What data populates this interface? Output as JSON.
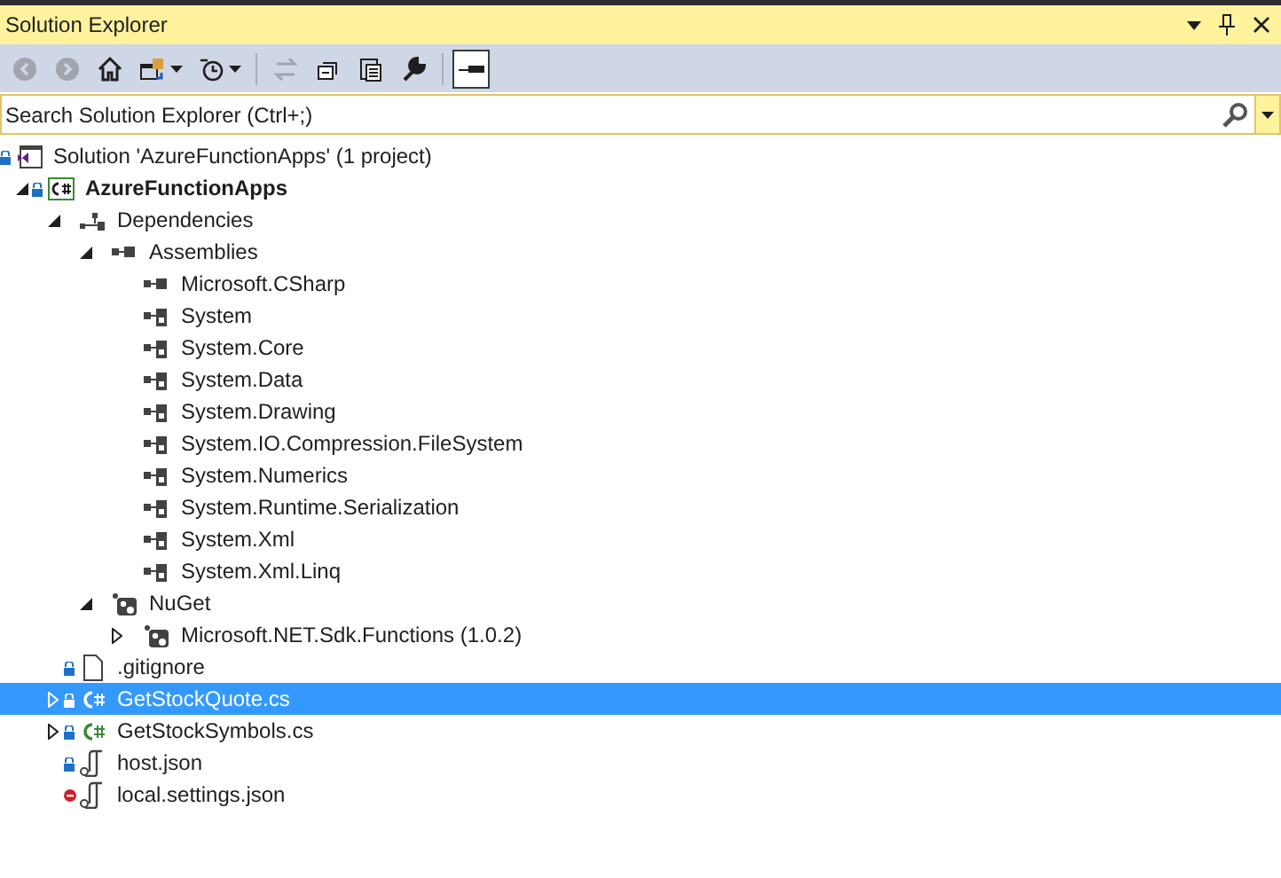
{
  "window": {
    "title": "Solution Explorer"
  },
  "toolbar": [
    {
      "disabled": true
    },
    {
      "disabled": true
    },
    {
      "disabled": false
    },
    {
      "disabled": false
    },
    {
      "disabled": false
    },
    {
      "disabled": true
    },
    {
      "disabled": false
    },
    {
      "disabled": false
    },
    {
      "disabled": false
    },
    {
      "disabled": false,
      "on": true
    }
  ],
  "search": {
    "placeholder": "Search Solution Explorer (Ctrl+;)"
  },
  "tree": [
    {
      "label": "Solution 'AzureFunctionApps' (1 project)",
      "kind": "solution",
      "locked": true,
      "excluded": false,
      "selected": false,
      "children": [
        {
          "label": "AzureFunctionApps",
          "kind": "project",
          "locked": true,
          "excluded": false,
          "expanded": true,
          "selected": false,
          "children": [
            {
              "label": "Dependencies",
              "kind": "dependencies",
              "expanded": true,
              "selected": false,
              "children": [
                {
                  "label": "Assemblies",
                  "kind": "assemblies",
                  "expanded": true,
                  "selected": false,
                  "children": [
                    {
                      "label": "Microsoft.CSharp",
                      "kind": "assembly",
                      "selected": false
                    },
                    {
                      "label": "System",
                      "kind": "framework-assembly",
                      "selected": false
                    },
                    {
                      "label": "System.Core",
                      "kind": "framework-assembly",
                      "selected": false
                    },
                    {
                      "label": "System.Data",
                      "kind": "framework-assembly",
                      "selected": false
                    },
                    {
                      "label": "System.Drawing",
                      "kind": "framework-assembly",
                      "selected": false
                    },
                    {
                      "label": "System.IO.Compression.FileSystem",
                      "kind": "framework-assembly",
                      "selected": false
                    },
                    {
                      "label": "System.Numerics",
                      "kind": "framework-assembly",
                      "selected": false
                    },
                    {
                      "label": "System.Runtime.Serialization",
                      "kind": "framework-assembly",
                      "selected": false
                    },
                    {
                      "label": "System.Xml",
                      "kind": "framework-assembly",
                      "selected": false
                    },
                    {
                      "label": "System.Xml.Linq",
                      "kind": "framework-assembly",
                      "selected": false
                    }
                  ]
                },
                {
                  "label": "NuGet",
                  "kind": "nuget",
                  "expanded": true,
                  "selected": false,
                  "children": [
                    {
                      "label": "Microsoft.NET.Sdk.Functions (1.0.2)",
                      "kind": "package",
                      "expanded": false,
                      "selected": false
                    }
                  ]
                }
              ]
            },
            {
              "label": ".gitignore",
              "kind": "file",
              "locked": true,
              "excluded": false,
              "selected": false
            },
            {
              "label": "GetStockQuote.cs",
              "kind": "csharp",
              "locked": true,
              "excluded": false,
              "expanded": false,
              "selected": true
            },
            {
              "label": "GetStockSymbols.cs",
              "kind": "csharp",
              "locked": true,
              "excluded": false,
              "expanded": false,
              "selected": false
            },
            {
              "label": "host.json",
              "kind": "json",
              "locked": true,
              "excluded": false,
              "selected": false
            },
            {
              "label": "local.settings.json",
              "kind": "json",
              "locked": false,
              "excluded": true,
              "selected": false
            }
          ]
        }
      ]
    }
  ]
}
